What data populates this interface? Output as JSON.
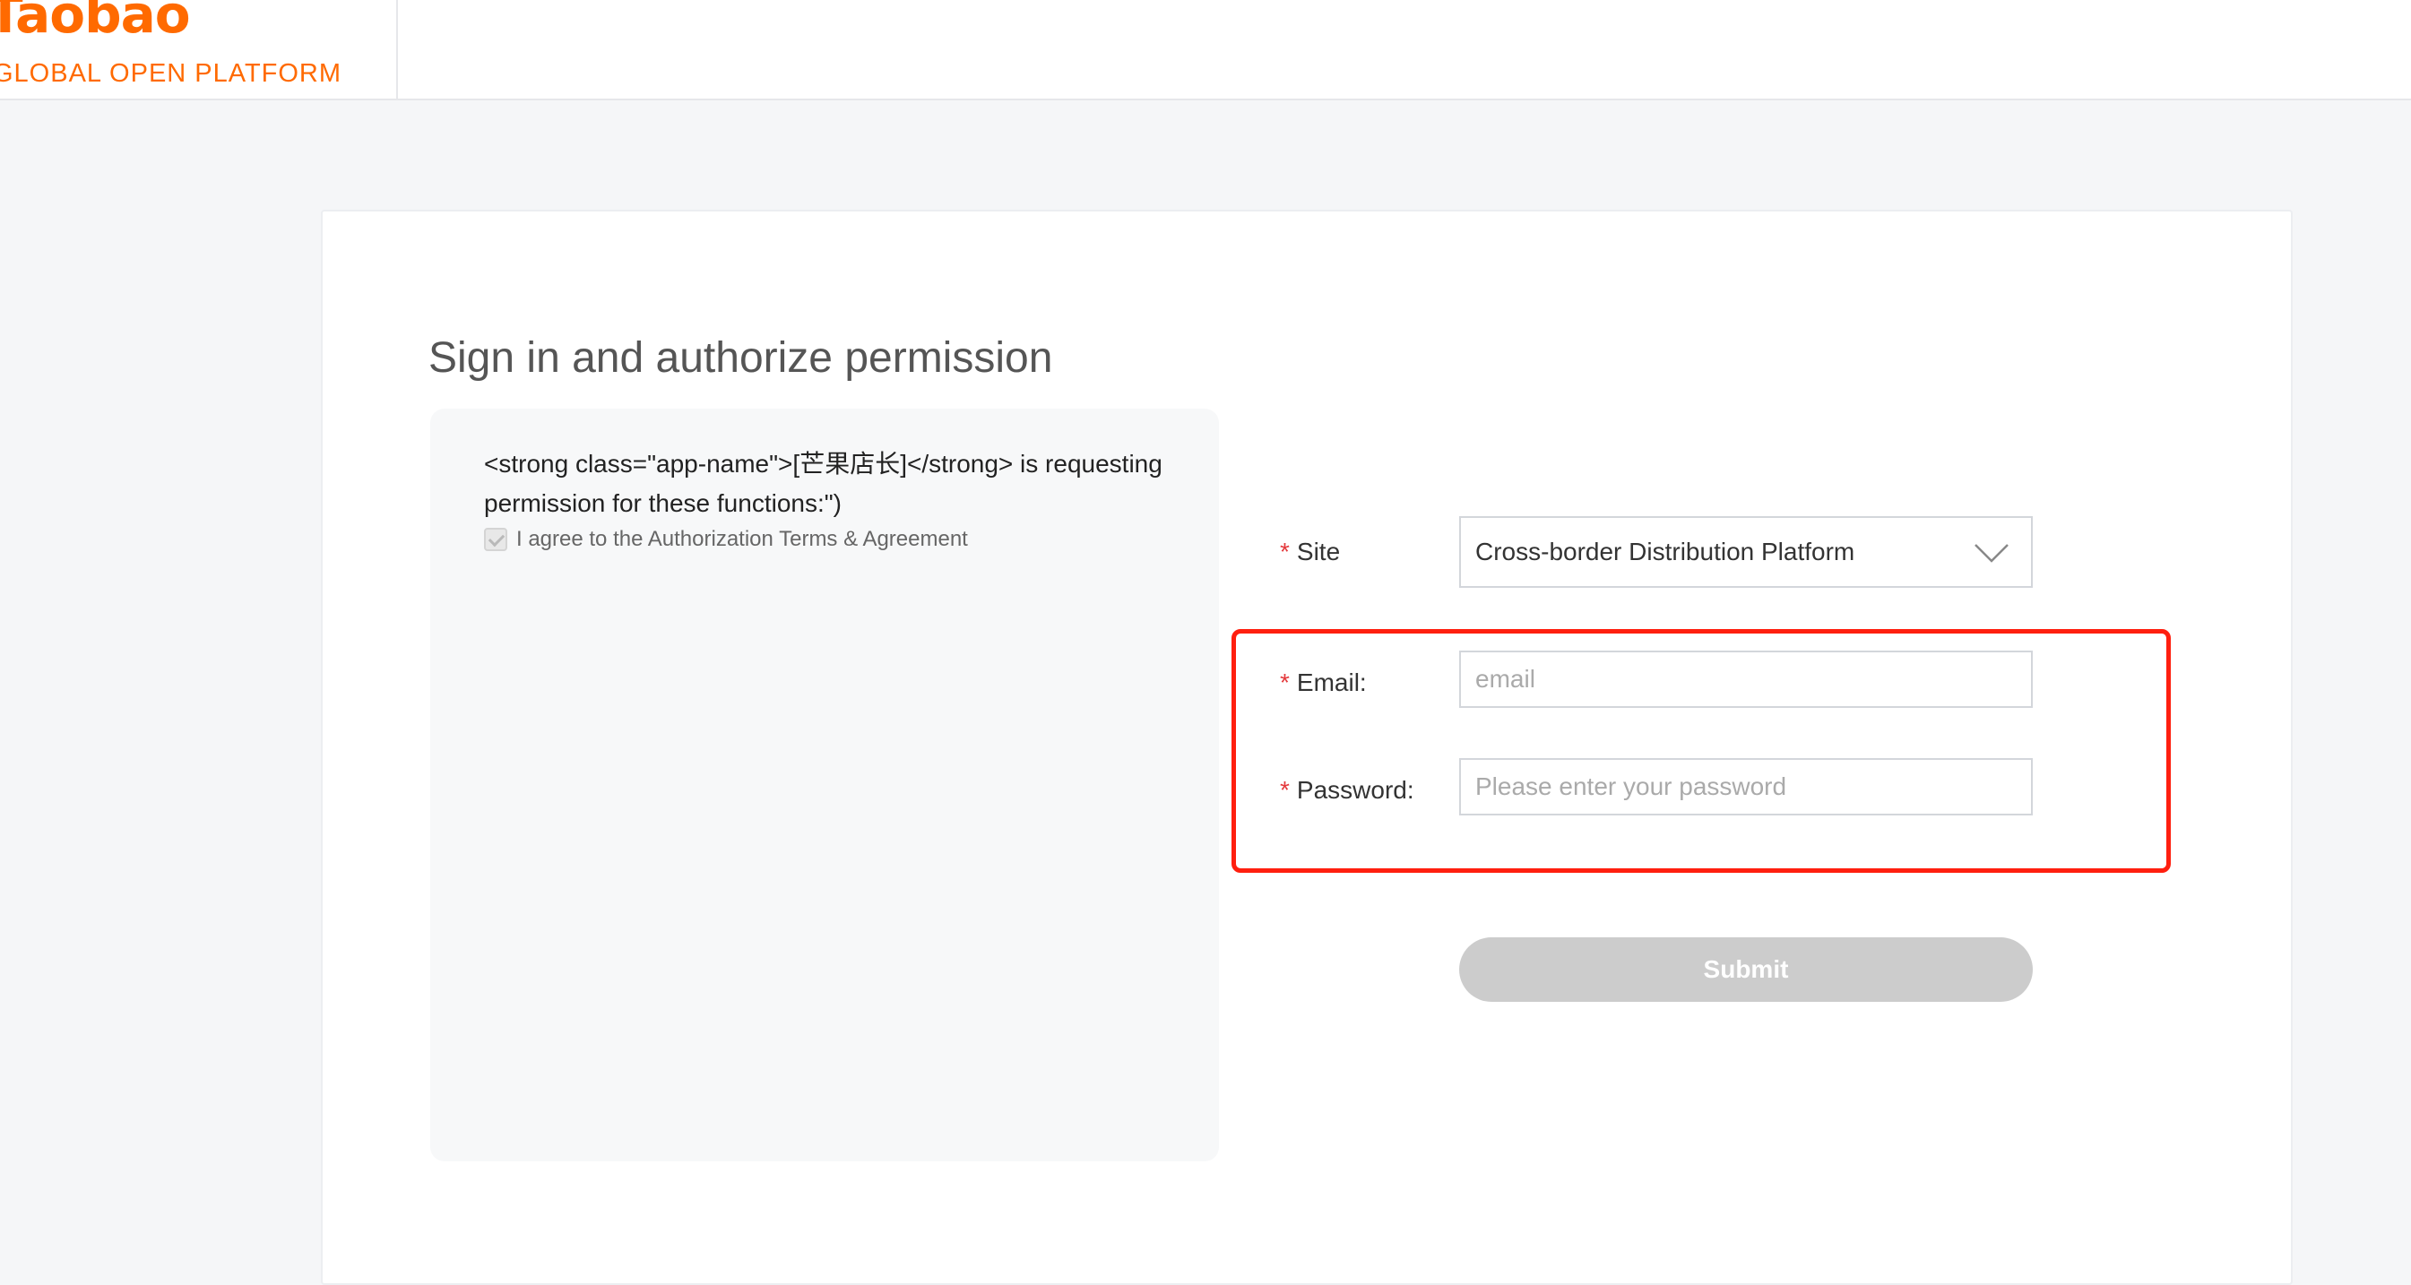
{
  "header": {
    "logo_title": "Taobao",
    "logo_subtitle": "GLOBAL OPEN PLATFORM"
  },
  "main": {
    "title": "Sign in and authorize permission",
    "permission_text": "<strong class=\"app-name\">[芒果店长]</strong> is requesting permission for these functions:\")",
    "agree_label": "I agree to the Authorization Terms & Agreement",
    "agree_checked": true
  },
  "form": {
    "site": {
      "label": "Site",
      "value": "Cross-border Distribution Platform"
    },
    "email": {
      "label": "Email:",
      "placeholder": "email",
      "value": ""
    },
    "password": {
      "label": "Password:",
      "placeholder": "Please enter your password",
      "value": ""
    },
    "required_mark": "*",
    "submit_label": "Submit"
  },
  "colors": {
    "brand": "#ff6a00",
    "required": "#e4393c",
    "highlight": "#ff1f0f",
    "submit_disabled": "#cccccc"
  }
}
